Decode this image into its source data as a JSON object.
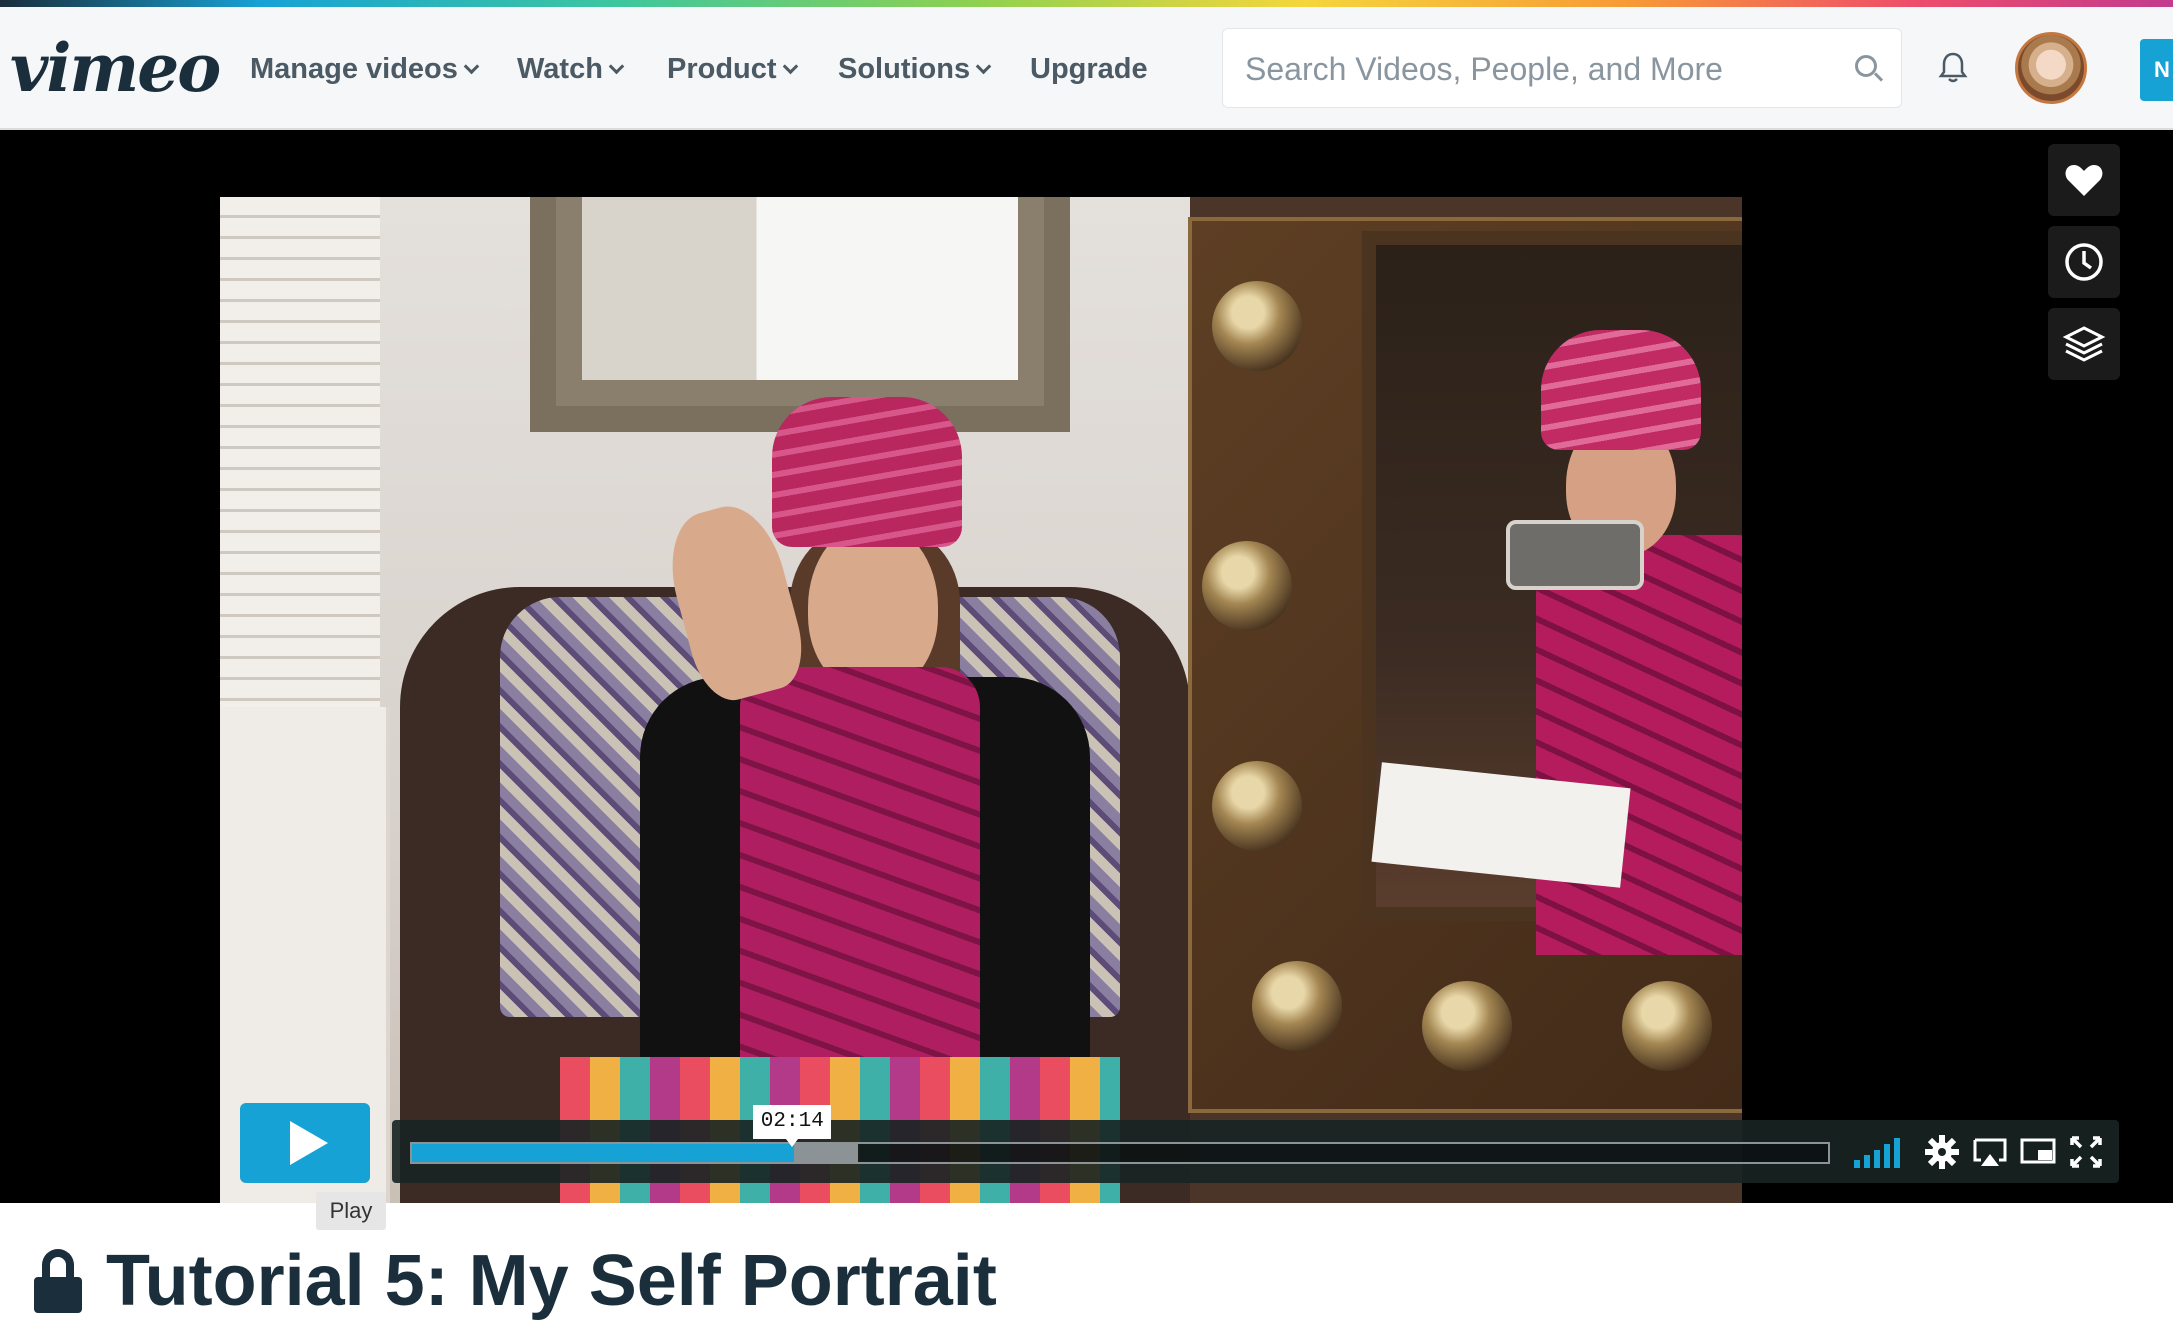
{
  "app": {
    "logo_text": "vimeo"
  },
  "nav": {
    "items": [
      {
        "label": "Manage videos",
        "has_dropdown": true
      },
      {
        "label": "Watch",
        "has_dropdown": true
      },
      {
        "label": "Product",
        "has_dropdown": true
      },
      {
        "label": "Solutions",
        "has_dropdown": true
      },
      {
        "label": "Upgrade",
        "has_dropdown": false
      }
    ]
  },
  "search": {
    "placeholder": "Search Videos, People, and More",
    "icon": "search-icon"
  },
  "header_right": {
    "new_button_label": "N",
    "icons": [
      "bell-icon",
      "avatar"
    ]
  },
  "player": {
    "side_buttons": [
      "heart-icon",
      "clock-icon",
      "layers-icon"
    ],
    "play_tooltip": "Play",
    "time_tooltip": "02:14",
    "progress_played": 0.27,
    "progress_buffered": 0.315,
    "controls": [
      "volume-bars-icon",
      "gear-icon",
      "airplay-icon",
      "pip-icon",
      "fullscreen-icon"
    ]
  },
  "video": {
    "title": "Tutorial 5: My Self Portrait",
    "privacy": "lock-icon"
  },
  "colors": {
    "accent": "#17a2d6",
    "text_dark": "#1a2e3b",
    "nav_text": "#4b5a64",
    "header_bg": "#f5f7f8"
  }
}
